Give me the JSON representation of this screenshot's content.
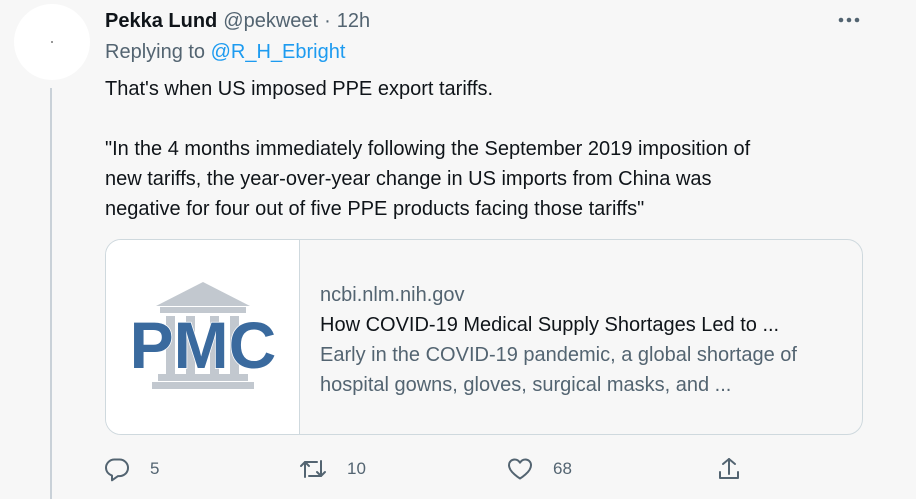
{
  "tweet": {
    "author_name": "Pekka Lund",
    "author_handle": "@pekweet",
    "separator": "·",
    "time": "12h",
    "replying_prefix": "Replying to ",
    "replying_to": "@R_H_Ebright",
    "text_line1": "That's when US imposed PPE export tariffs.",
    "text_quote": "\"In the 4 months immediately following the September 2019 imposition of\nnew tariffs, the year-over-year change in US imports from China was\nnegative for four out of five PPE products facing those tariffs\""
  },
  "card": {
    "thumbnail_text": "PMC",
    "domain": "ncbi.nlm.nih.gov",
    "title": "How COVID-19 Medical Supply Shortages Led to ...",
    "description": "Early in the COVID-19 pandemic, a global shortage of hospital gowns, gloves, surgical masks, and ..."
  },
  "actions": {
    "replies": "5",
    "retweets": "10",
    "likes": "68"
  },
  "icons": {
    "more": "more-horizontal-icon",
    "reply": "reply-icon",
    "retweet": "retweet-icon",
    "like": "heart-icon",
    "share": "share-icon"
  },
  "colors": {
    "link": "#1d9bf0",
    "secondary_text": "#536471",
    "primary_text": "#0f1419",
    "pmc_blue": "#3a6a9e"
  }
}
